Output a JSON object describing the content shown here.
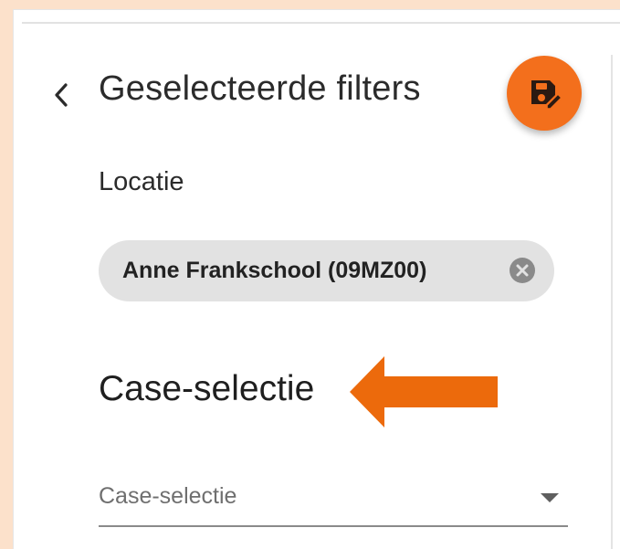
{
  "panel": {
    "title": "Geselecteerde filters",
    "back_icon": "chevron-left-icon",
    "save_icon": "save-edit-icon",
    "accent_color": "#f36f1c"
  },
  "location": {
    "label": "Locatie",
    "chip_label": "Anne Frankschool (09MZ00)",
    "chip_remove_icon": "close-circle-icon"
  },
  "case_selection": {
    "heading": "Case-selectie",
    "select": {
      "placeholder": "Case-selectie",
      "dropdown_icon": "caret-down-icon"
    }
  },
  "annotation": {
    "icon": "orange-arrow-left",
    "color": "#f36f1c"
  }
}
